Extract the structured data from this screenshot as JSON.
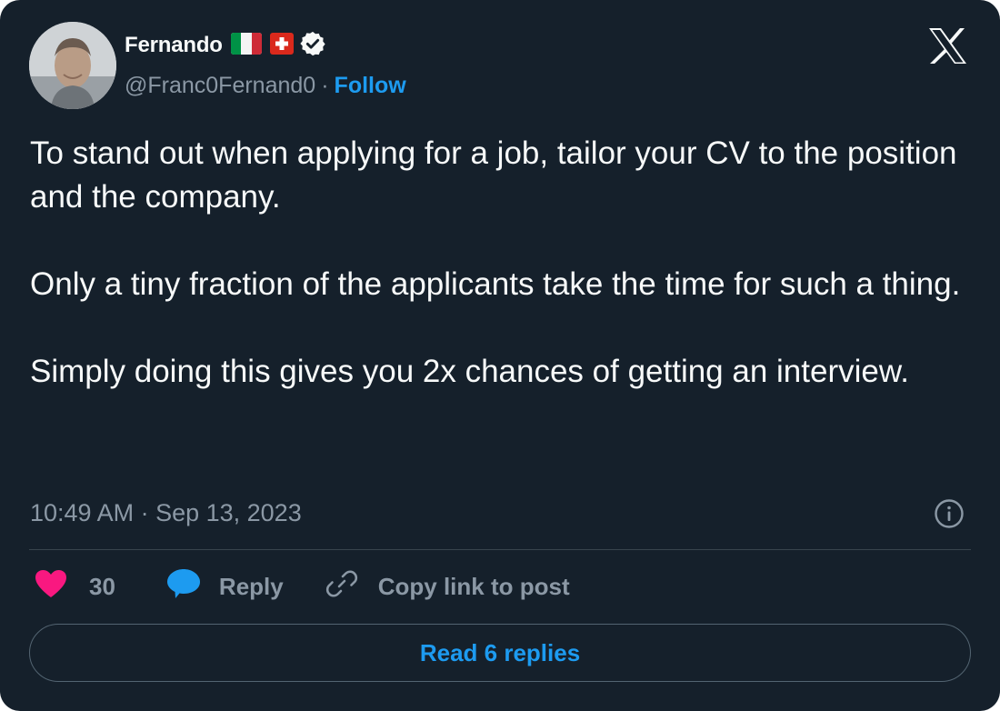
{
  "author": {
    "name": "Fernando",
    "flags": [
      "italy-flag",
      "switzerland-flag"
    ],
    "verified": true,
    "handle": "@Franc0Fernand0",
    "separator": "·",
    "follow_label": "Follow"
  },
  "post": {
    "paragraphs": [
      "To stand out when applying for a job, tailor your CV to the position and the company.",
      "Only a tiny fraction of the applicants take the time for such a thing.",
      "Simply doing this gives you 2x chances of getting an interview."
    ],
    "timestamp": "10:49 AM · Sep 13, 2023"
  },
  "actions": {
    "like_count": "30",
    "reply_label": "Reply",
    "copy_label": "Copy link to post"
  },
  "footer": {
    "read_replies_label": "Read 6 replies"
  },
  "icons": {
    "brand": "x-logo-icon",
    "info": "info-icon",
    "like": "heart-icon",
    "reply": "speech-bubble-icon",
    "copy": "link-icon"
  },
  "colors": {
    "background": "#15202b",
    "text": "#f7f9f9",
    "muted": "#8b98a5",
    "accent": "#1d9bf0",
    "like": "#f91880",
    "divider": "#38444d"
  }
}
